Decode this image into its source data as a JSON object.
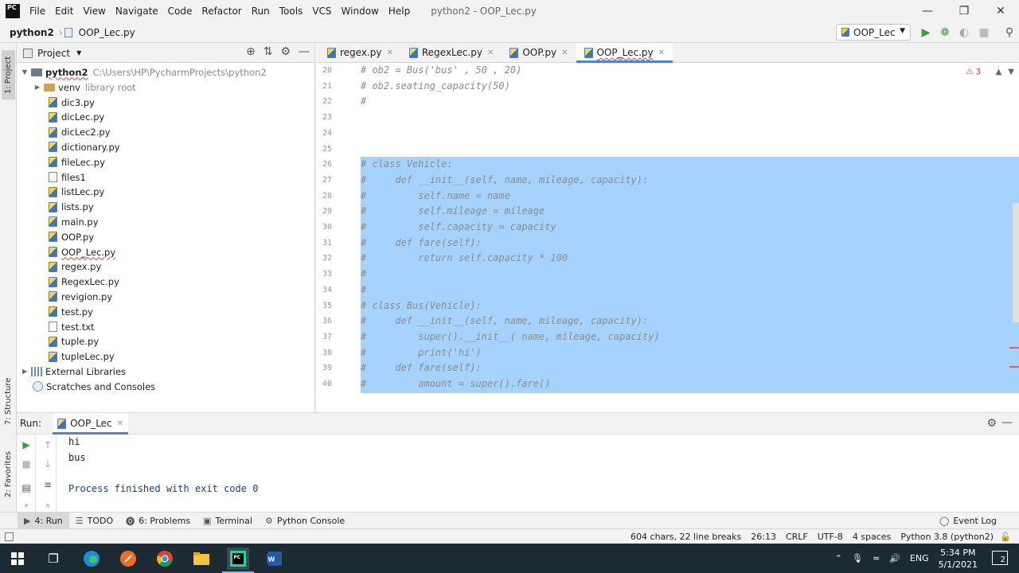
{
  "menubar": {
    "logo_text": "PC",
    "items": [
      "File",
      "Edit",
      "View",
      "Navigate",
      "Code",
      "Refactor",
      "Run",
      "Tools",
      "VCS",
      "Window",
      "Help"
    ],
    "window_title": "python2 - OOP_Lec.py"
  },
  "navbar": {
    "project": "python2",
    "file": "OOP_Lec.py",
    "run_config": "OOP_Lec"
  },
  "sidebar_tabs": {
    "project": "1: Project",
    "structure": "7: Structure",
    "favorites": "2: Favorites"
  },
  "project_panel": {
    "title": "Project",
    "root_name": "python2",
    "root_path": "C:\\Users\\HP\\PycharmProjects\\python2",
    "venv_name": "venv",
    "venv_note": "library root",
    "files": [
      "dic3.py",
      "dicLec.py",
      "dicLec2.py",
      "dictionary.py",
      "fileLec.py",
      "files1",
      "listLec.py",
      "lists.py",
      "main.py",
      "OOP.py",
      "OOP_Lec.py",
      "regex.py",
      "RegexLec.py",
      "revigion.py",
      "test.py",
      "test.txt",
      "tuple.py",
      "tupleLec.py"
    ],
    "external_libraries": "External Libraries",
    "scratches": "Scratches and Consoles"
  },
  "editor": {
    "tabs": [
      "regex.py",
      "RegexLec.py",
      "OOP.py",
      "OOP_Lec.py"
    ],
    "active_tab": "OOP_Lec.py",
    "warning_count": "3",
    "line_numbers": [
      "20",
      "21",
      "22",
      "23",
      "24",
      "25",
      "26",
      "27",
      "28",
      "29",
      "30",
      "31",
      "32",
      "33",
      "34",
      "35",
      "36",
      "37",
      "38",
      "39",
      "40"
    ],
    "lines": [
      "# ob2 = Bus('bus' , 50 , 20)",
      "# ob2.seating_capacity(50)",
      "#",
      "",
      "",
      "",
      "# class Vehicle:",
      "#     def __init__(self, name, mileage, capacity):",
      "#         self.name = name",
      "#         self.mileage = mileage",
      "#         self.capacity = capacity",
      "#     def fare(self):",
      "#         return self.capacity * 100",
      "#",
      "#",
      "# class Bus(Vehicle):",
      "#     def __init__(self, name, mileage, capacity):",
      "#         super().__init__( name, mileage, capacity)",
      "#         print('hi')",
      "#     def fare(self):",
      "#         amount = super().fare()"
    ]
  },
  "run_panel": {
    "label": "Run:",
    "tab": "OOP_Lec",
    "output": [
      "hi",
      "bus",
      "",
      "Process finished with exit code 0"
    ]
  },
  "bottom_tabs": [
    {
      "icon": "▶",
      "label": "4: Run"
    },
    {
      "icon": "☰",
      "label": "TODO"
    },
    {
      "icon": "⓿",
      "label": "6: Problems"
    },
    {
      "icon": "▣",
      "label": "Terminal"
    },
    {
      "icon": "⚙",
      "label": "Python Console"
    }
  ],
  "event_log": "Event Log",
  "status": {
    "chars": "604 chars, 22 line breaks",
    "position": "26:13",
    "line_sep": "CRLF",
    "encoding": "UTF-8",
    "indent": "4 spaces",
    "interpreter": "Python 3.8 (python2)"
  },
  "taskbar": {
    "lang": "ENG",
    "time": "5:34 PM",
    "date": "5/1/2021",
    "notifications": "2"
  }
}
